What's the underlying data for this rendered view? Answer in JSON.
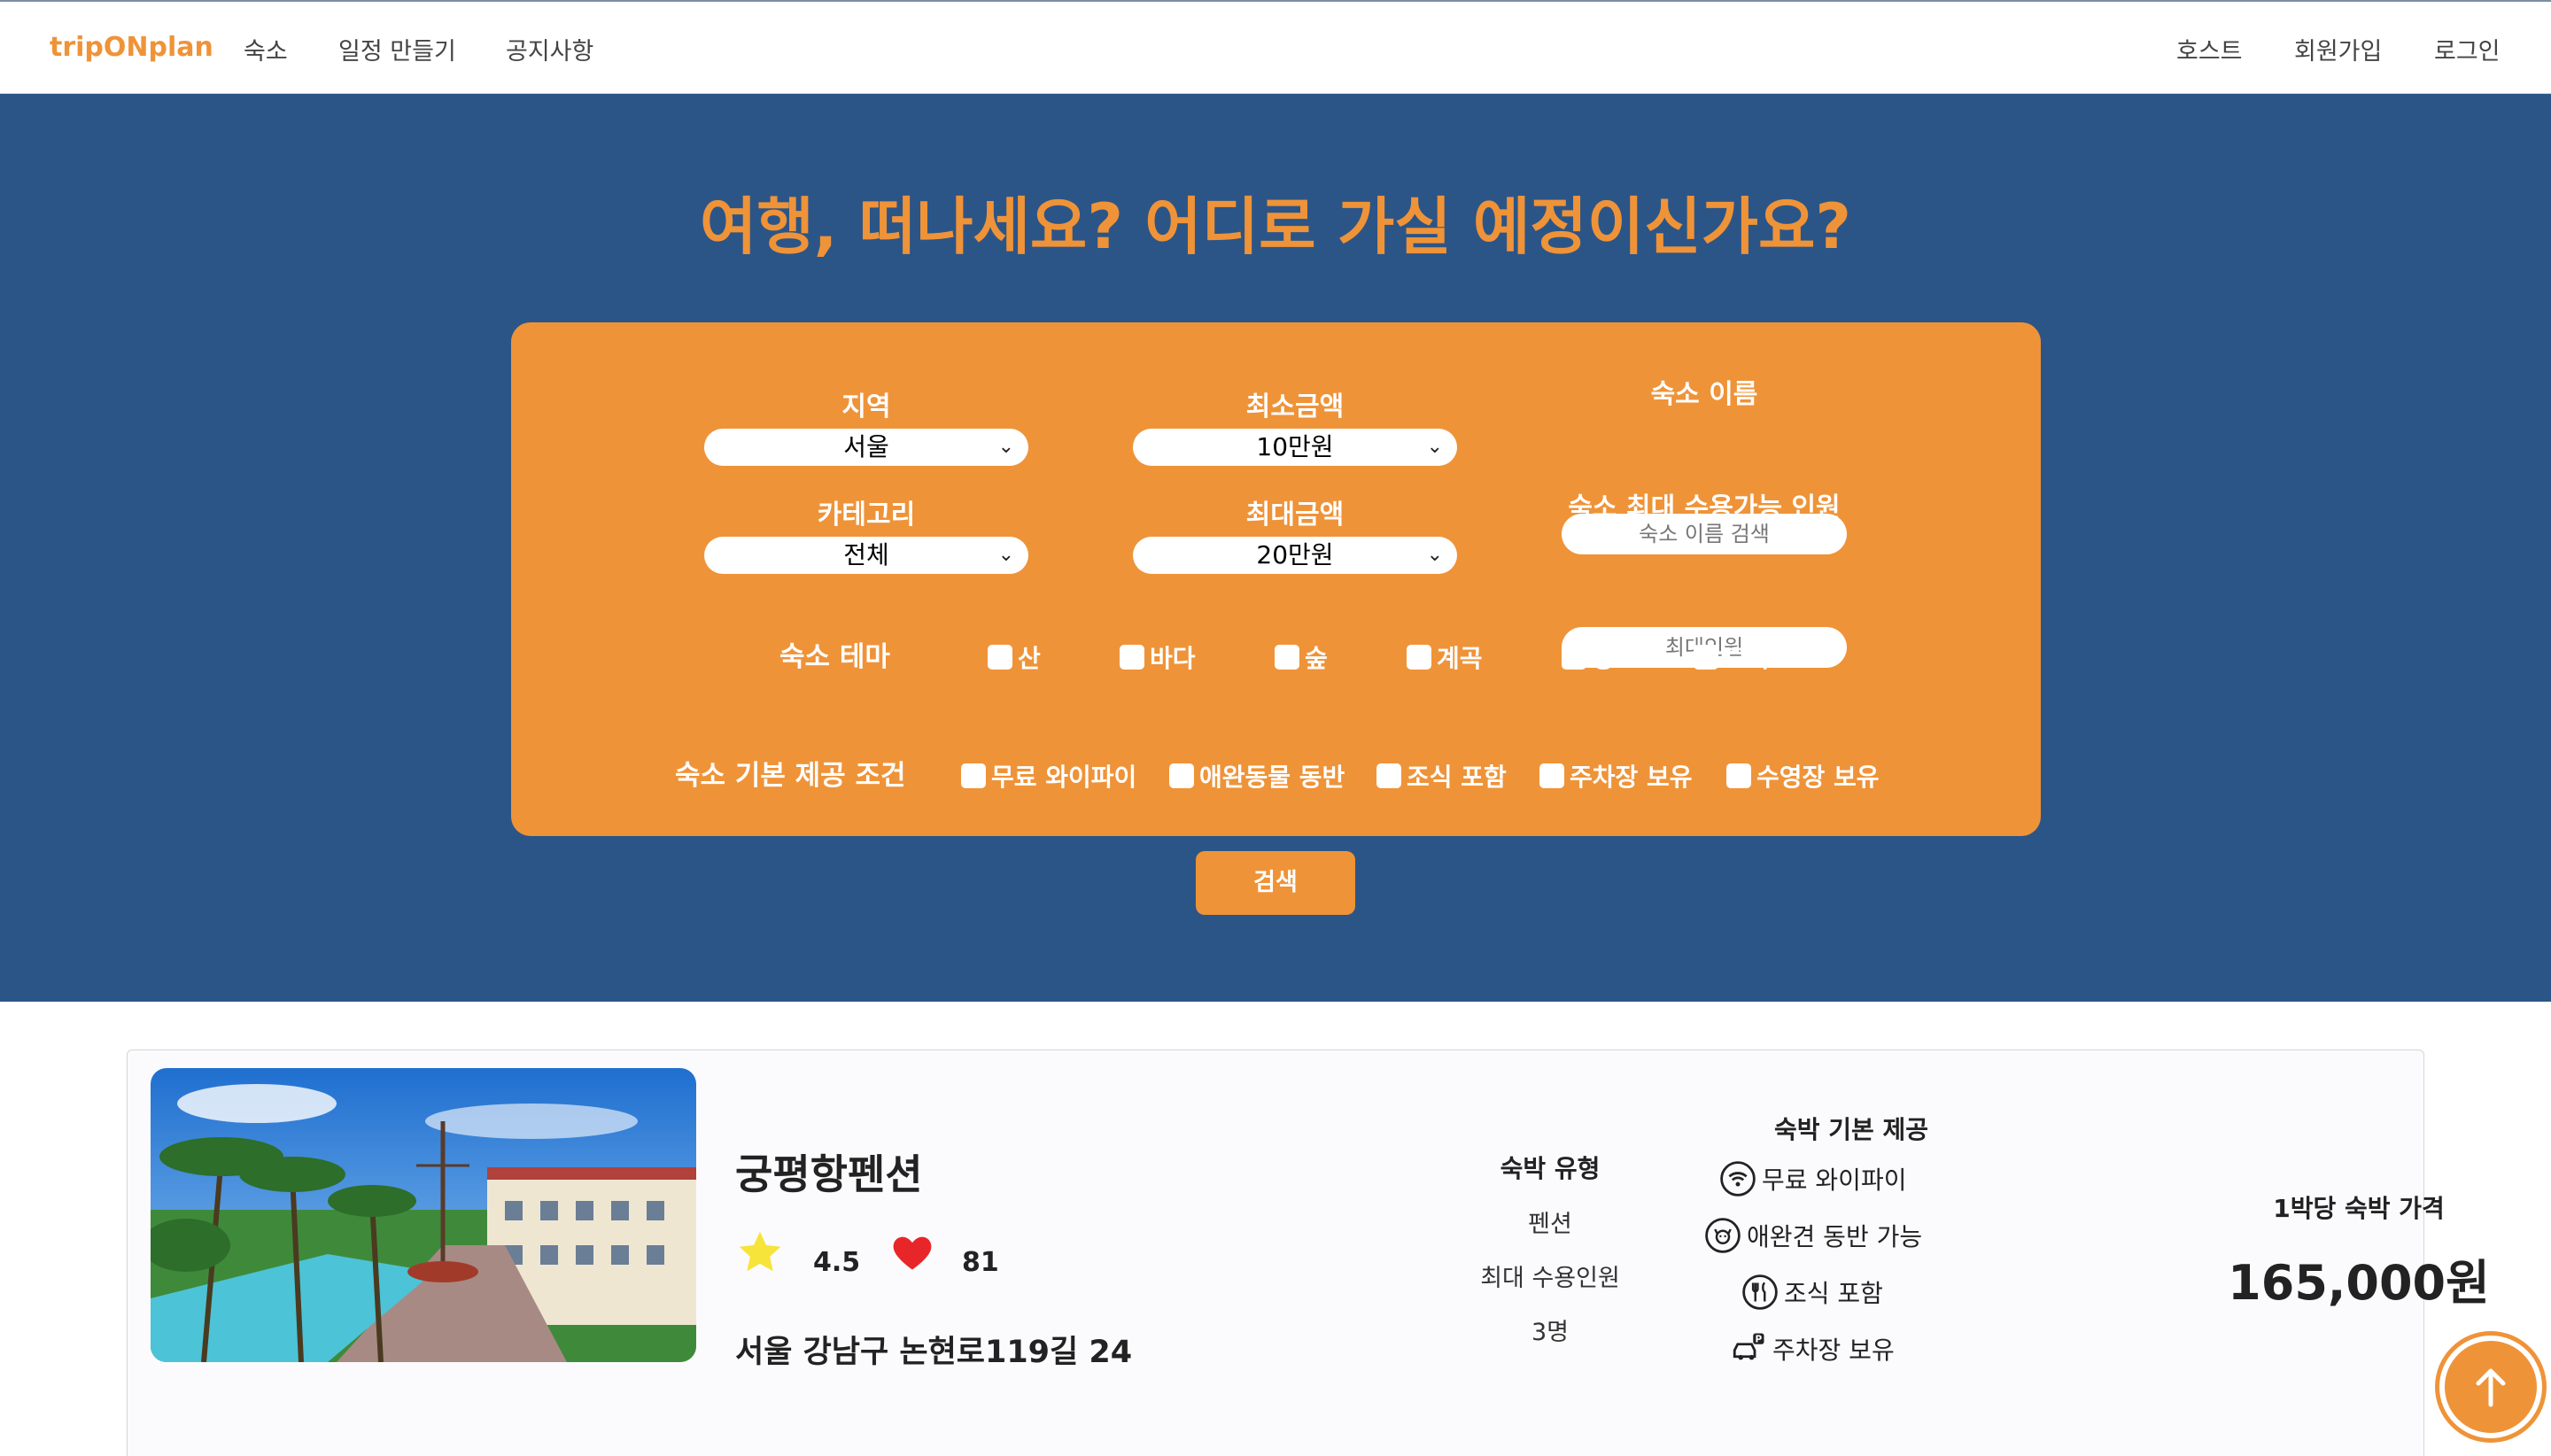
{
  "nav": {
    "brand": "tripONplan",
    "links": [
      "숙소",
      "일정 만들기",
      "공지사항"
    ],
    "right_links": [
      "호스트",
      "회원가입",
      "로그인"
    ]
  },
  "hero": {
    "title": "여행, 떠나세요? 어디로 가실 예정이신가요?"
  },
  "search": {
    "region_label": "지역",
    "region_value": "서울",
    "category_label": "카테고리",
    "category_value": "전체",
    "min_price_label": "최소금액",
    "min_price_value": "10만원",
    "max_price_label": "최대금액",
    "max_price_value": "20만원",
    "name_label": "숙소 이름",
    "name_placeholder": "숙소 이름 검색",
    "capacity_label": "숙소 최대 수용가능 인원",
    "capacity_placeholder": "최대인원",
    "theme_label": "숙소 테마",
    "themes": [
      "산",
      "바다",
      "숲",
      "계곡",
      "강",
      "도시"
    ],
    "amenity_label": "숙소 기본 제공 조건",
    "amenities": [
      "무료 와이파이",
      "애완동물 동반",
      "조식 포함",
      "주차장 보유",
      "수영장 보유"
    ],
    "button": "검색"
  },
  "listing": {
    "name": "궁평항펜션",
    "rating": "4.5",
    "likes": "81",
    "address": "서울 강남구 논현로119길 24",
    "type_label": "숙박 유형",
    "type_value": "펜션",
    "capacity_label": "최대 수용인원",
    "capacity_value": "3명",
    "amenities_label": "숙박 기본 제공",
    "amenities": [
      "무료 와이파이",
      "애완견 동반 가능",
      "조식 포함",
      "주차장 보유"
    ],
    "price_label": "1박당 숙박 가격",
    "price": "165,000원"
  },
  "colors": {
    "accent": "#ef9338",
    "hero_bg": "#2c5587",
    "star": "#f7e43a",
    "heart": "#e8262a"
  },
  "icons": {
    "scroll_top": "arrow-up-icon",
    "select": "chevron-down-icon",
    "rating": "star-icon",
    "likes": "heart-icon"
  }
}
